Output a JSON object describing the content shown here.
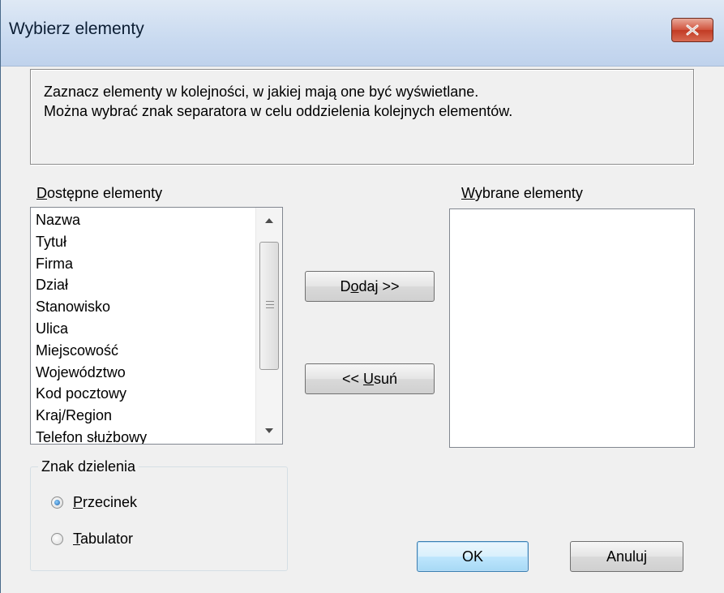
{
  "window": {
    "title": "Wybierz elementy",
    "close_glyph": "X"
  },
  "info": {
    "line1": "Zaznacz elementy w kolejności, w jakiej mają one być wyświetlane.",
    "line2": "Można wybrać znak separatora w celu oddzielenia kolejnych elementów."
  },
  "available": {
    "label_mnemonic": "D",
    "label_rest": "ostępne elementy",
    "items": [
      "Nazwa",
      "Tytuł",
      "Firma",
      "Dział",
      "Stanowisko",
      "Ulica",
      "Miejscowość",
      "Województwo",
      "Kod pocztowy",
      "Kraj/Region",
      "Telefon służbowy"
    ]
  },
  "selected": {
    "label_mnemonic": "W",
    "label_rest": "ybrane elementy",
    "items": []
  },
  "buttons": {
    "add_pre": "D",
    "add_mnemonic": "o",
    "add_post": "daj >>",
    "remove_pre": "<< ",
    "remove_mnemonic": "U",
    "remove_post": "suń",
    "ok": "OK",
    "cancel_pre": "Anulu",
    "cancel_mnemonic": "j"
  },
  "separator": {
    "group_title": "Znak dzielenia",
    "options": [
      {
        "mnemonic": "P",
        "rest": "rzecinek",
        "checked": true
      },
      {
        "mnemonic": "T",
        "rest": "abulator",
        "checked": false
      }
    ]
  },
  "colors": {
    "title_bar": "#c9daf0",
    "close_button": "#c13b24",
    "ok_button_border": "#3c7fb1",
    "dialog_bg": "#f0f0f0"
  }
}
